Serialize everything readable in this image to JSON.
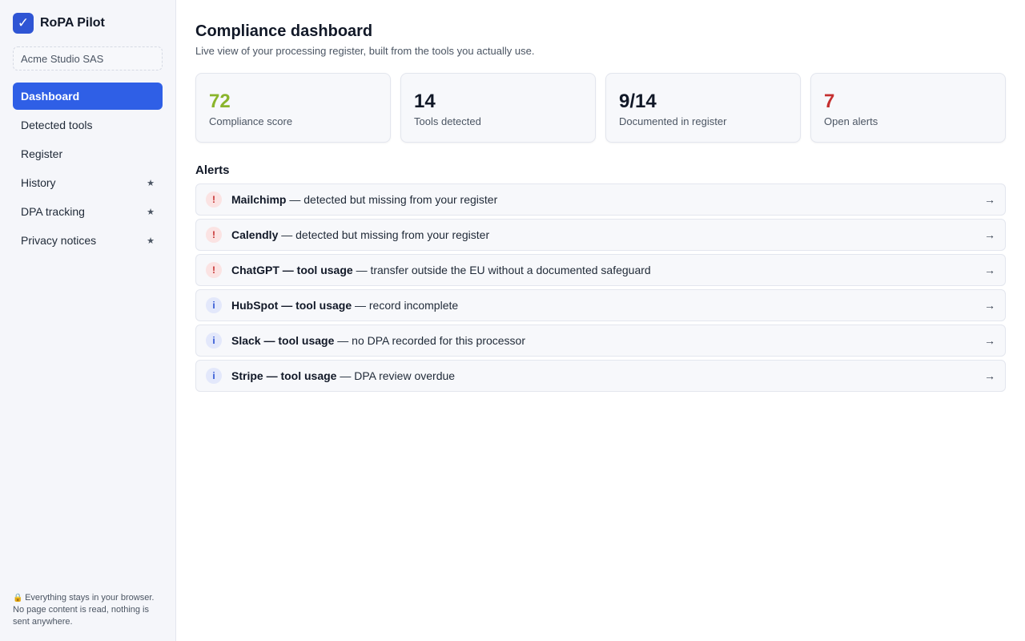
{
  "app": {
    "name": "RoPA Pilot",
    "logo_glyph": "✓",
    "workspace": "Acme Studio SAS"
  },
  "sidebar": {
    "items": [
      {
        "label": "Dashboard",
        "active": true,
        "star": ""
      },
      {
        "label": "Detected tools",
        "active": false,
        "star": ""
      },
      {
        "label": "Register",
        "active": false,
        "star": ""
      },
      {
        "label": "History",
        "active": false,
        "star": "★"
      },
      {
        "label": "DPA tracking",
        "active": false,
        "star": "★"
      },
      {
        "label": "Privacy notices",
        "active": false,
        "star": "★"
      }
    ],
    "footer_icon": "🔒",
    "footer_text": "Everything stays in your browser. No page content is read, nothing is sent anywhere."
  },
  "header": {
    "title": "Compliance dashboard",
    "subtitle": "Live view of your processing register, built from the tools you actually use."
  },
  "stats": [
    {
      "value": "72",
      "label": "Compliance score",
      "color": "#8ab52c"
    },
    {
      "value": "14",
      "label": "Tools detected",
      "color": "#111827"
    },
    {
      "value": "9/14",
      "label": "Documented in register",
      "color": "#111827"
    },
    {
      "value": "7",
      "label": "Open alerts",
      "color": "#c53030"
    }
  ],
  "alerts_section": {
    "title": "Alerts",
    "items": [
      {
        "severity": "error",
        "glyph": "!",
        "subject": "Mailchimp",
        "message": " — detected but missing from your register",
        "arrow": "→"
      },
      {
        "severity": "error",
        "glyph": "!",
        "subject": "Calendly",
        "message": " — detected but missing from your register",
        "arrow": "→"
      },
      {
        "severity": "error",
        "glyph": "!",
        "subject": "ChatGPT — tool usage",
        "message": " — transfer outside the EU without a documented safeguard",
        "arrow": "→"
      },
      {
        "severity": "info",
        "glyph": "i",
        "subject": "HubSpot — tool usage",
        "message": " — record incomplete",
        "arrow": "→"
      },
      {
        "severity": "info",
        "glyph": "i",
        "subject": "Slack — tool usage",
        "message": " — no DPA recorded for this processor",
        "arrow": "→"
      },
      {
        "severity": "info",
        "glyph": "i",
        "subject": "Stripe — tool usage",
        "message": " — DPA review overdue",
        "arrow": "→"
      }
    ]
  }
}
